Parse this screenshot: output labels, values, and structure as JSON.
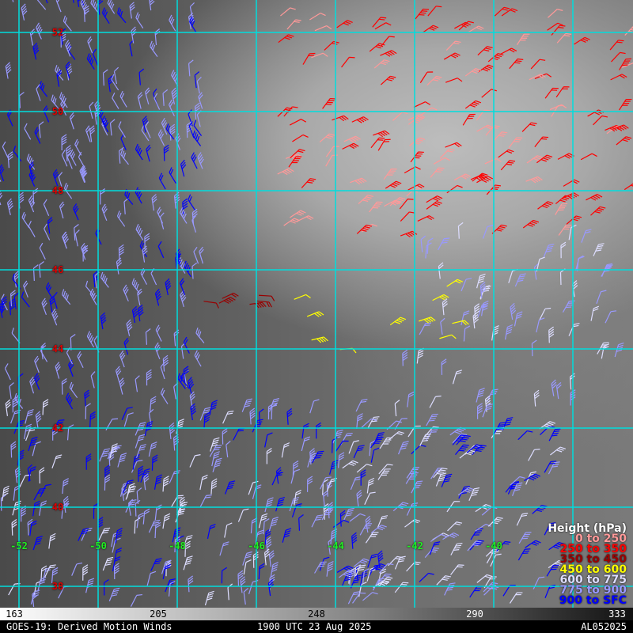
{
  "latitudes": [
    "52",
    "50",
    "48",
    "46",
    "44",
    "42",
    "40",
    "38"
  ],
  "longitudes": [
    "-52",
    "-50",
    "-48",
    "-46",
    "-44",
    "-42",
    "-40"
  ],
  "legend": {
    "title": "Height (hPa)",
    "items": [
      {
        "label": "0 to 250",
        "color": "#ff9999"
      },
      {
        "label": "250 to 350",
        "color": "#ff0000"
      },
      {
        "label": "350 to 450",
        "color": "#990000"
      },
      {
        "label": "450 to 600",
        "color": "#ffff00"
      },
      {
        "label": "600 to 775",
        "color": "#ddddff"
      },
      {
        "label": "775 to 900",
        "color": "#9999ff"
      },
      {
        "label": "900 to SFC",
        "color": "#0000ff"
      }
    ]
  },
  "colorbar": {
    "ticks": [
      "163",
      "205",
      "248",
      "290",
      "333"
    ]
  },
  "footer": {
    "title": "GOES-19: Derived Motion Winds",
    "time": "1900 UTC 23 Aug 2025",
    "storm_id": "AL052025"
  },
  "grid_color": "#00dddd"
}
